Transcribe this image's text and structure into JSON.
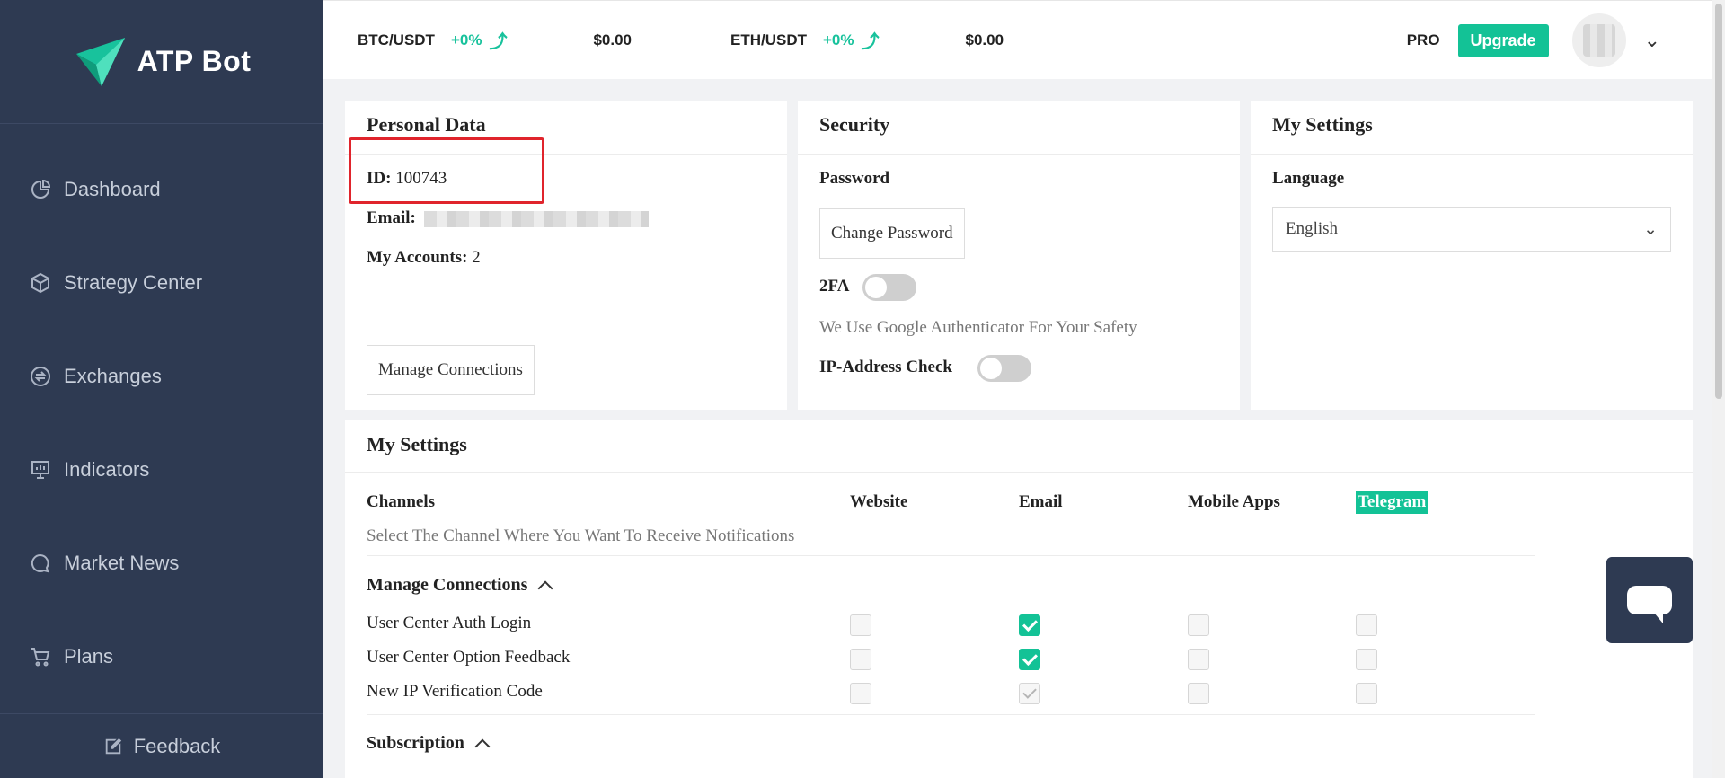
{
  "brand": {
    "name": "ATP Bot"
  },
  "sidebar": {
    "items": [
      {
        "label": "Dashboard",
        "icon": "pie-chart-icon"
      },
      {
        "label": "Strategy Center",
        "icon": "cube-icon"
      },
      {
        "label": "Exchanges",
        "icon": "exchange-icon"
      },
      {
        "label": "Indicators",
        "icon": "monitor-icon"
      },
      {
        "label": "Market News",
        "icon": "chat-dots-icon"
      },
      {
        "label": "Plans",
        "icon": "cart-icon"
      }
    ],
    "feedback": "Feedback"
  },
  "topbar": {
    "tickers": [
      {
        "pair": "BTC/USDT",
        "change": "+0%",
        "price": "$0.00"
      },
      {
        "pair": "ETH/USDT",
        "change": "+0%",
        "price": "$0.00"
      }
    ],
    "plan": "PRO",
    "upgrade": "Upgrade"
  },
  "personal": {
    "title": "Personal Data",
    "id_label": "ID:",
    "id_value": "100743",
    "email_label": "Email:",
    "accounts_label": "My Accounts:",
    "accounts_value": "2",
    "manage_button": "Manage Connections"
  },
  "security": {
    "title": "Security",
    "password_label": "Password",
    "change_password": "Change Password",
    "twofa_label": "2FA",
    "twofa_note": "We Use Google Authenticator For Your Safety",
    "ip_label": "IP-Address Check"
  },
  "settings": {
    "title": "My Settings",
    "language_label": "Language",
    "language_value": "English"
  },
  "notifications": {
    "title": "My Settings",
    "channels_label": "Channels",
    "channels_hint": "Select The Channel Where You Want To Receive Notifications",
    "columns": [
      "Website",
      "Email",
      "Mobile Apps",
      "Telegram"
    ],
    "section1": "Manage Connections",
    "rows": [
      "User Center Auth Login",
      "User Center Option Feedback",
      "New IP Verification Code"
    ],
    "section2": "Subscription"
  },
  "colors": {
    "accent": "#13c296",
    "sidebar": "#2e3a52",
    "highlight": "#e0242c"
  }
}
